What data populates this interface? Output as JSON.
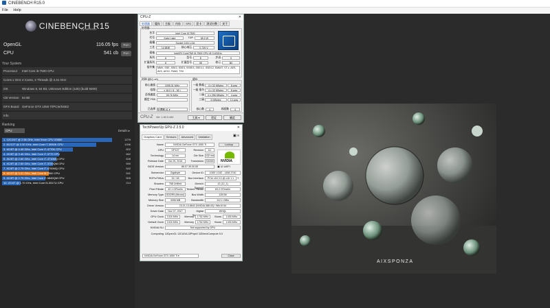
{
  "app": {
    "title": "CINEBENCH R15.0",
    "menu": [
      "File",
      "Help"
    ]
  },
  "cinebench": {
    "logo_text": "CINEBENCH R15",
    "logo_sub": "by MAXON",
    "scores": [
      {
        "label": "OpenGL",
        "value": "116.05 fps",
        "button": "Run"
      },
      {
        "label": "CPU",
        "value": "541 cb",
        "button": "Run"
      }
    ],
    "system_header": "Your System",
    "system": [
      {
        "key": "Processor",
        "value": "Intel Core i5-7500 CPU"
      },
      {
        "key": "Cores x GHz",
        "value": "4 Cores, 4 Threads @ 3.41 GHz"
      },
      {
        "key": "OS",
        "value": "Windows 8, 64 Bit, Unknown Edition (125) (build 9200)"
      },
      {
        "key": "CB Version",
        "value": "64 Bit"
      },
      {
        "key": "GFX Board",
        "value": "GeForce GTX 1050 Ti/PCIe/SSE2"
      },
      {
        "key": "Info",
        "value": ""
      }
    ],
    "ranking_header": "Ranking",
    "ranking_dropdown": "CPU",
    "ranking_details": "Details",
    "ranking": [
      {
        "label": "1. 12C/24T @ 2.66 GHz, Intel Xeon CPU X5650",
        "score": 1279,
        "color": "#2b67b8"
      },
      {
        "label": "2. 6C/12T @ 3.30 GHz, Intel Core i7-3930K CPU",
        "score": 1096,
        "color": "#2b67b8"
      },
      {
        "label": "3. 4C/8T @ 4.40 GHz, Intel Core i7-4770K CPU",
        "score": 822,
        "color": "#2b67b8"
      },
      {
        "label": "4. 4C/8T @ 3.40 GHz, Intel Core i7-3770 CPU",
        "score": 662,
        "color": "#2b67b8"
      },
      {
        "label": "5. 4C/8T @ 2.60 GHz, Intel Core i7-4710MQ CPU",
        "score": 628,
        "color": "#2b67b8"
      },
      {
        "label": "6. 4C/8T @ 2.60 GHz, Intel Core i7-3720QM CPU",
        "score": 590,
        "color": "#2b67b8"
      },
      {
        "label": "7. 4C/8T @ 2.79 GHz, Intel Core i7-4700MQ CPU",
        "score": 542,
        "color": "#2b67b8"
      },
      {
        "label": "8. 4C/4T @ 3.41 GHz, Intel Core i5-7500 CPU",
        "score": 541,
        "color": "#e07b24"
      },
      {
        "label": "9. 4C/8T @ 2.79 GHz, Intel Core i7-3840QM CPU",
        "score": 505,
        "color": "#2b67b8"
      },
      {
        "label": "10. 2C/4T @ 1.70 GHz, Intel Core i5-3317U CPU",
        "score": 214,
        "color": "#2b67b8"
      }
    ]
  },
  "cpuz": {
    "title": "CPU-Z",
    "tabs": [
      "处理器",
      "缓存",
      "主板",
      "内存",
      "SPD",
      "显卡",
      "测试分数",
      "关于"
    ],
    "group_processor": "处理器",
    "name_label": "名字",
    "name": "Intel Core i5 7500",
    "codename_label": "代号",
    "codename": "Kaby Lake",
    "tdp_label": "TDP",
    "tdp": "65.0 W",
    "package_label": "插槽",
    "package": "Socket 1151 LGA",
    "tech_label": "工艺",
    "tech": "14 纳米",
    "voltage_label": "核心电压",
    "voltage": "0.739 V",
    "spec_label": "规格",
    "spec": "Intel(R) Core(TM) i5-7500 CPU @ 3.40GHz",
    "family_label": "系列",
    "family": "6",
    "model_label": "型号",
    "model": "E",
    "stepping_label": "步进",
    "stepping": "9",
    "extfamily_label": "扩展系列",
    "extfamily": "6",
    "extmodel_label": "扩展型号",
    "extmodel": "9E",
    "revision_label": "修订",
    "revision": "B0",
    "instr_label": "指令集",
    "instr": "MMX, SSE, SSE2, SSE3, SSSE3, SSE4.1, SSE4.2, EM64T, VT-x, AES, AVX, AVX2, FMA3, TSX",
    "clocks_group": "时钟 (核心 #0)",
    "cache_group": "缓存",
    "core_speed_label": "核心速度",
    "core_speed": "1095.31 MHz",
    "multiplier_label": "倍频",
    "multiplier": "x 16.0 ( 8 - 38 )",
    "bus_label": "总线速度",
    "bus": "99.76 MHz",
    "fsb_label": "额定 FSB",
    "fsb": "",
    "l1d_label": "一级 数据",
    "l1d": "4 x 32 KBytes",
    "l1d_way": "8-way",
    "l1i_label": "一级 指令",
    "l1i": "4 x 32 KBytes",
    "l1i_way": "8-way",
    "l2_label": "二级",
    "l2": "4 x 256 KBytes",
    "l2_way": "4-way",
    "l3_label": "三级",
    "l3": "6 MBytes",
    "l3_way": "12-way",
    "selection_label": "已选择",
    "selection": "处理器 #1",
    "cores_label": "核心数",
    "cores": "4",
    "threads_label": "线程数",
    "threads": "4",
    "version": "Ver. 1.82.0.x64",
    "tools_btn": "工具",
    "validate_btn": "验证",
    "ok_btn": "确定"
  },
  "gpuz": {
    "title": "TechPowerUp GPU-Z 2.5.0",
    "tabs": [
      "Graphics Card",
      "Sensors",
      "Advanced",
      "Validation"
    ],
    "lookup": "Lookup",
    "uefi": "UEFI",
    "rows": {
      "name_label": "Name",
      "name": "NVIDIA GeForce GTX 1050 Ti",
      "gpu_label": "GPU",
      "gpu": "GP107",
      "revision_label": "Revision",
      "revision": "A1",
      "tech_label": "Technology",
      "tech": "14 nm",
      "die_label": "Die Size",
      "die": "132 mm²",
      "release_label": "Release Date",
      "release": "Oct 25, 2016",
      "transistors_label": "Transistors",
      "transistors": "3300M",
      "bios_label": "BIOS Version",
      "bios": "86.07.39.00.55",
      "subvendor_label": "Subvendor",
      "subvendor": "Gigabyte",
      "devid_label": "Device ID",
      "devid": "10DE 1C82 - 1458 3740",
      "rops_label": "ROPs/TMUs",
      "rops": "32 / 48",
      "busif_label": "Bus Interface",
      "busif": "PCIe x16 3.0 @ x16 1.1",
      "shaders_label": "Shaders",
      "shaders": "768 Unified",
      "dx_label": "DirectX Support",
      "dx": "12 (12_1)",
      "pixel_label": "Pixel Fillrate",
      "pixel": "42.1 GPixel/s",
      "texture_label": "Texture Fillrate",
      "texture": "63.2 GTexel/s",
      "memtype_label": "Memory Type",
      "memtype": "GDDR5 (Micron)",
      "buswidth_label": "Bus Width",
      "buswidth": "128 Bit",
      "memsize_label": "Memory Size",
      "memsize": "4096 MB",
      "bandwidth_label": "Bandwidth",
      "bandwidth": "112.1 GB/s",
      "driver_label": "Driver Version",
      "driver": "23.21.13.8843 (NVIDIA 388.43) / Win10 64",
      "driverdate_label": "Driver Date",
      "driverdate": "Nov 27, 2017",
      "digsig_label": "Digital Signature",
      "digsig": "WHQL",
      "gpuclock_label": "GPU Clock",
      "gpuclock": "1316 MHz",
      "mem1_label": "Memory",
      "mem1": "1752 MHz",
      "boost1_label": "Boost",
      "boost1": "1430 MHz",
      "defclock_label": "Default Clock",
      "defclock": "1316 MHz",
      "mem2_label": "Memory",
      "mem2": "1752 MHz",
      "boost2_label": "Boost",
      "boost2": "1430 MHz",
      "sli_label": "NVIDIA SLI",
      "sli": "Not supported by GPU",
      "computing_label": "Computing",
      "computing": [
        "OpenCL",
        "CUDA",
        "PhysX",
        "DirectCompute 5.0"
      ]
    },
    "select": "NVIDIA GeForce GTX 1050 Ti",
    "close": "Close"
  },
  "render": {
    "brand": "AIXSPONZA"
  }
}
